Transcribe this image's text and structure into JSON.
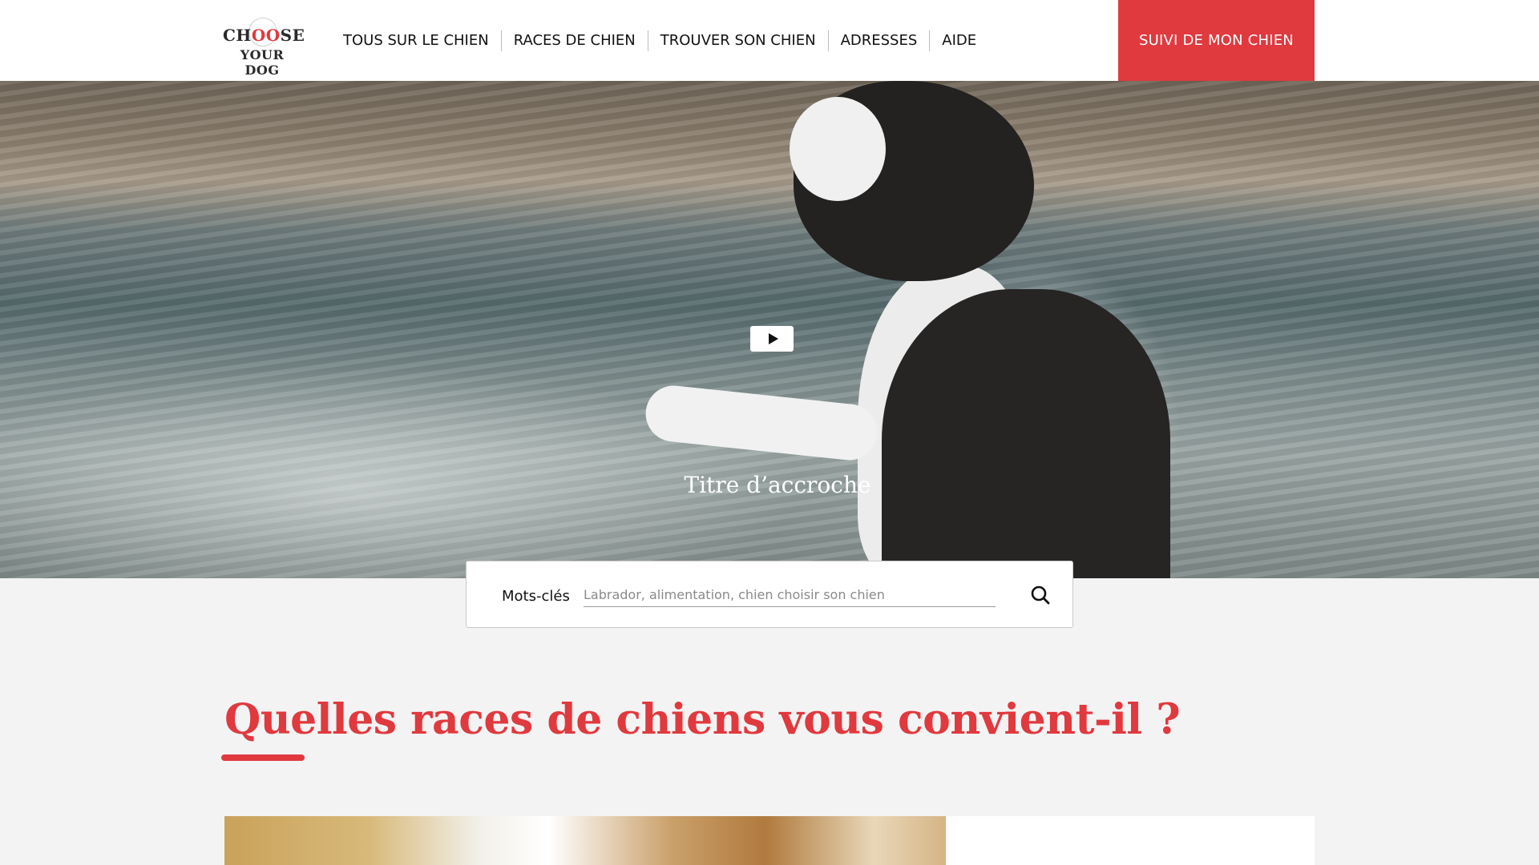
{
  "header": {
    "logo": {
      "line1_a": "CH",
      "line1_oo": "OO",
      "line1_b": "SE",
      "line2": "YOUR DOG"
    },
    "nav": [
      {
        "label": "TOUS SUR LE CHIEN"
      },
      {
        "label": "RACES DE CHIEN"
      },
      {
        "label": "TROUVER SON CHIEN"
      },
      {
        "label": "ADRESSES"
      },
      {
        "label": "AIDE"
      }
    ],
    "cta_label": "SUIVI DE MON CHIEN"
  },
  "hero": {
    "title": "Titre d’accroche",
    "play_icon": "play-icon"
  },
  "search": {
    "label": "Mots-clés",
    "placeholder": "Labrador, alimentation, chien choisir son chien",
    "value": "",
    "icon": "search-icon"
  },
  "section": {
    "title": "Quelles races de chiens vous convient-il ?"
  },
  "colors": {
    "accent": "#e0393e",
    "header_bg": "#ffffff",
    "page_bg": "#f3f3f3"
  }
}
